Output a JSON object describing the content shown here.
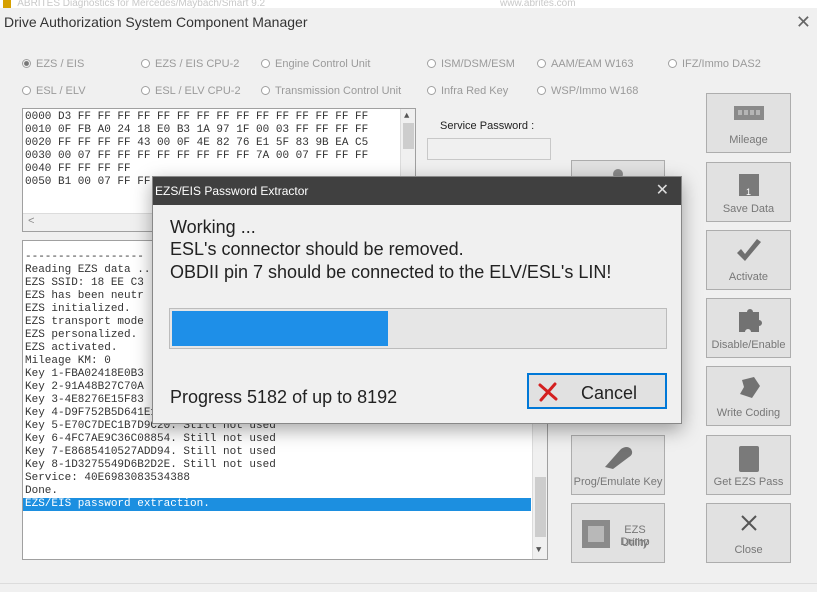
{
  "app": {
    "background_title": "ABRITES Diagnostics for Mercedes/Maybach/Smart 9.2",
    "background_url": "www.abrites.com",
    "window_title": "Drive Authorization System Component Manager",
    "close_glyph": "✕"
  },
  "modules": {
    "row1": [
      "EZS / EIS",
      "EZS / EIS CPU-2",
      "Engine Control Unit",
      "ISM/DSM/ESM",
      "AAM/EAM W163",
      "IFZ/Immo DAS2"
    ],
    "row2": [
      "ESL / ELV",
      "ESL / ELV CPU-2",
      "Transmission Control Unit",
      "Infra Red Key",
      "WSP/Immo W168"
    ],
    "selected": "EZS / EIS"
  },
  "hex_dump": {
    "lines": [
      "0000 D3 FF FF FF FF FF FF FF FF FF FF FF FF FF FF FF",
      "0010 0F FB A0 24 18 E0 B3 1A 97 1F 00 03 FF FF FF FF",
      "0020 FF FF FF FF 43 00 0F 4E 82 76 E1 5F 83 9B EA C5",
      "0030 00 07 FF FF FF FF FF FF FF FF 7A 00 07 FF FF FF",
      "0040 FF FF FF FF",
      "0050 B1 00 07 FF FF"
    ]
  },
  "service_password": {
    "label": "Service Password :",
    "value": ""
  },
  "log": {
    "lines": [
      "------------------",
      "Reading EZS data ...",
      "EZS SSID: 18 EE C3",
      "EZS has been neutr",
      "EZS initialized.",
      "EZS transport mode",
      "EZS personalized.",
      "EZS activated.",
      "Mileage KM: 0",
      "Key 1-FBA02418E0B3",
      "Key 2-91A48B27C70A",
      "Key 3-4E8276E15F83",
      "Key 4-D9F752B5D641E166. Still not used",
      "Key 5-E70C7DEC1B7D9C20. Still not used",
      "Key 6-4FC7AE9C36C08854. Still not used",
      "Key 7-E8685410527ADD94. Still not used",
      "Key 8-1D3275549D6B2D2E. Still not used",
      "Service: 40E6983083534388",
      "Done."
    ],
    "selected_line": "EZS/EIS password extraction."
  },
  "buttons": {
    "mileage": "Mileage",
    "save_data": "Save Data",
    "activate": "Activate",
    "disable_enable": "Disable/Enable",
    "write_coding": "Write Coding",
    "prog_emulate_key": "Prog/Emulate Key",
    "get_ezs_pass": "Get EZS Pass",
    "ezs_dump_utility_line1": "EZS Dump",
    "ezs_dump_utility_line2": "Utility",
    "close": "Close",
    "save_data_icon_digit": "1"
  },
  "dialog": {
    "title": "EZS/EIS Password Extractor",
    "status": "Working ...",
    "line1": "ESL's connector should be removed.",
    "line2": "OBDII pin 7 should be connected to the ELV/ESL's LIN!",
    "progress_text": "Progress 5182 of up to 8192",
    "progress_current": 5182,
    "progress_max": 8192,
    "cancel_label": "Cancel"
  },
  "colors": {
    "accent": "#1e8fe8",
    "dialog_bar": "#404040",
    "cancel_icon": "#d42020"
  }
}
